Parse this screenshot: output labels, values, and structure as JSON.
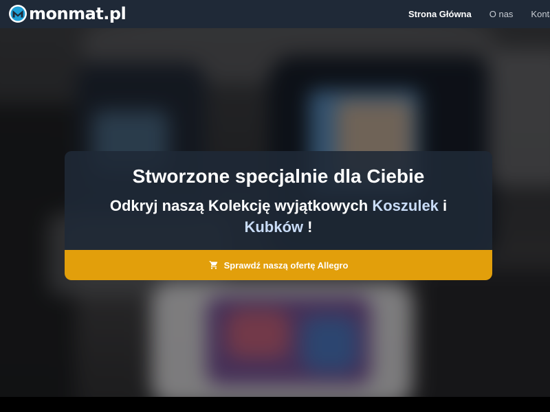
{
  "brand": {
    "name": "monmat.pl",
    "logo_icon": "m-logo-icon",
    "color": "#ffffff"
  },
  "nav": {
    "items": [
      {
        "label": "Strona Główna",
        "active": true
      },
      {
        "label": "O nas",
        "active": false
      },
      {
        "label": "Kontakt",
        "active": false
      }
    ]
  },
  "hero": {
    "title": "Stworzone specjalnie dla Ciebie",
    "subtitle_part1": "Odkryj naszą Kolekcję wyjątkowych ",
    "highlight1": "Koszulek",
    "subtitle_part2": " i ",
    "highlight2": "Kubków",
    "subtitle_part3": " !",
    "cta_label": "Sprawdź naszą ofertę Allegro",
    "cta_icon": "shopping-cart-icon"
  },
  "colors": {
    "navbar": "#1f2937",
    "cta": "#e29f0b",
    "highlight": "#c9dcf7",
    "logo_accent": "#1ea0d7"
  }
}
